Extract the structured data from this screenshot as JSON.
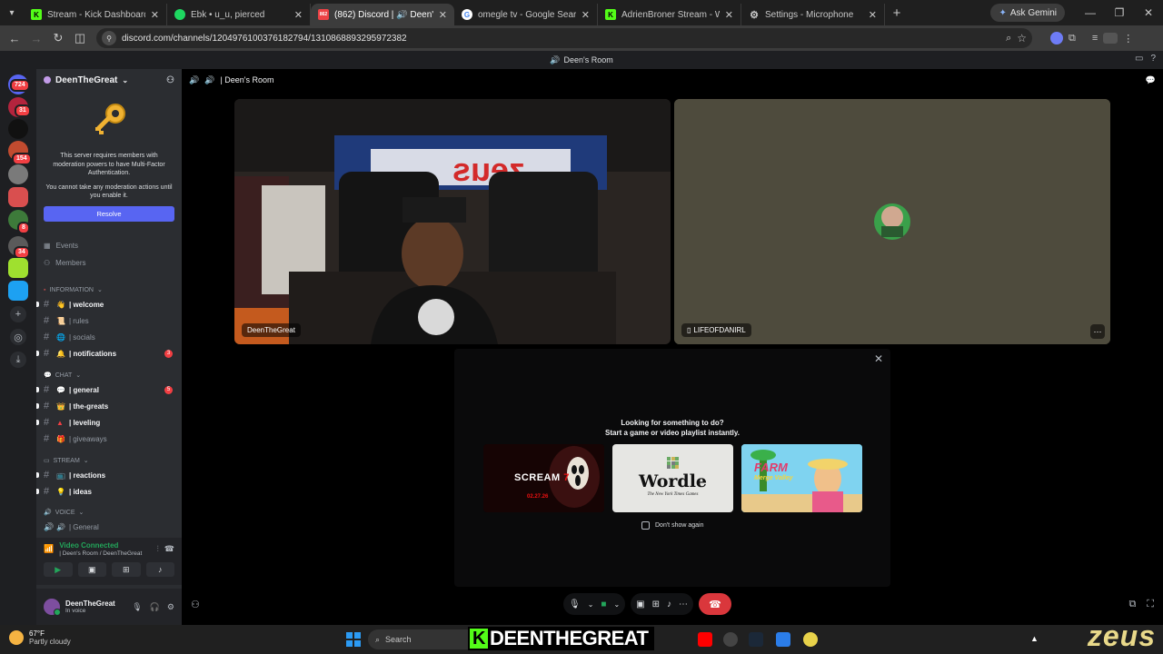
{
  "browser": {
    "tabs": [
      {
        "label": "Stream - Kick Dashboard",
        "favicon": "kick-icon",
        "color": "#53fc18",
        "glyph": "K"
      },
      {
        "label": "Ebk • u_u, pierced",
        "favicon": "spotify-icon",
        "color": "#1ed760",
        "glyph": ""
      },
      {
        "label": "(862) Discord | 🔊 Deen's R",
        "favicon": "discord-icon",
        "color": "#ed4245",
        "glyph": "862",
        "active": true
      },
      {
        "label": "omegle tv - Google Search",
        "favicon": "google-icon",
        "color": "#ffffff",
        "glyph": "G"
      },
      {
        "label": "AdrienBroner Stream - Watch L",
        "favicon": "kick-icon",
        "color": "#53fc18",
        "glyph": "K"
      },
      {
        "label": "Settings - Microphone",
        "favicon": "gear-icon",
        "color": "#c7c7c7",
        "glyph": "⚙"
      }
    ],
    "ask_gemini": "Ask Gemini",
    "url": "discord.com/channels/1204976100376182794/1310868893295972382"
  },
  "discord": {
    "title_center": "Deen's Room",
    "server_name": "DeenTheGreat",
    "mfa_text": "This server requires members with moderation powers to have Multi-Factor Authentication.",
    "mfa_text2": "You cannot take any moderation actions until you enable it.",
    "resolve_label": "Resolve",
    "events_label": "Events",
    "members_label": "Members",
    "categories": {
      "information": "INFORMATION",
      "chat": "CHAT",
      "stream": "STREAM",
      "voice": "VOICE"
    },
    "channels": {
      "welcome": "| welcome",
      "rules": "| rules",
      "socials": "| socials",
      "notifications": "| notifications",
      "notifications_badge": "3",
      "general": "| general",
      "general_badge": "5",
      "the_greats": "| the-greats",
      "leveling": "| leveling",
      "giveaways": "| giveaways",
      "reactions": "| reactions",
      "ideas": "| ideas",
      "voice_general": "| General"
    },
    "voice_connected": "Video Connected",
    "voice_location": "| Deen's Room / DeenTheGreat",
    "user_name": "DeenTheGreat",
    "user_status": "In voice",
    "guild_badges": [
      "724",
      "31",
      "154",
      "8",
      "34"
    ],
    "stage_header": "| Deen's Room",
    "tiles": [
      {
        "name": "DeenTheGreat"
      },
      {
        "name": "LIFEOFDANIRL"
      }
    ],
    "activity_title_1": "Looking for something to do?",
    "activity_title_2": "Start a game or video playlist instantly.",
    "activity_cards": [
      "Scream 7",
      "Wordle",
      "Farm Merge Valley"
    ],
    "scream_title": "SCREAM",
    "scream_num": "7",
    "scream_date": "02.27.26",
    "wordle_title": "Wordle",
    "wordle_sub": "The New York Times Games",
    "farm_title": "FARM",
    "farm_sub": "Merge Valley",
    "dont_show": "Don't show again"
  },
  "taskbar": {
    "temp": "67°F",
    "weather": "Partly cloudy",
    "search": "Search",
    "overlay_name": "DEENTHEGREAT",
    "overlay_k": "K",
    "zeus": "zeus"
  }
}
